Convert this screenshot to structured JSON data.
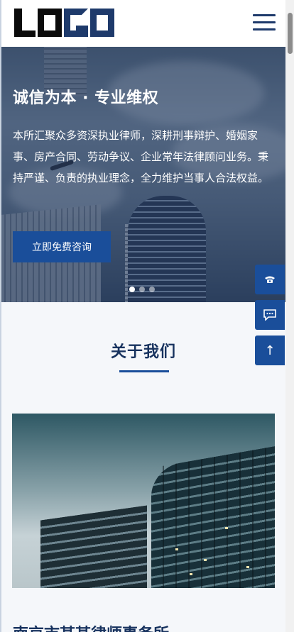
{
  "header": {
    "logo_text": "LOGO",
    "menu_icon": "hamburger-menu-icon"
  },
  "hero": {
    "title": "诚信为本 · 专业维权",
    "description": "本所汇聚众多资深执业律师，深耕刑事辩护、婚姻家事、房产合同、劳动争议、企业常年法律顾问业务。秉持严谨、负责的执业理念，全力维护当事人合法权益。",
    "cta_label": "立即免费咨询",
    "slide_count": 3,
    "active_slide": 1
  },
  "about": {
    "title": "关于我们",
    "subheading": "南京市某某律师事务所"
  },
  "floating": {
    "phone_icon": "phone-icon",
    "chat_icon": "chat-icon",
    "top_label": "↑"
  },
  "colors": {
    "accent": "#1a4e9a",
    "heading": "#17325e",
    "logo_dark": "#0b0b0b",
    "logo_blue": "#1e3a6b"
  }
}
